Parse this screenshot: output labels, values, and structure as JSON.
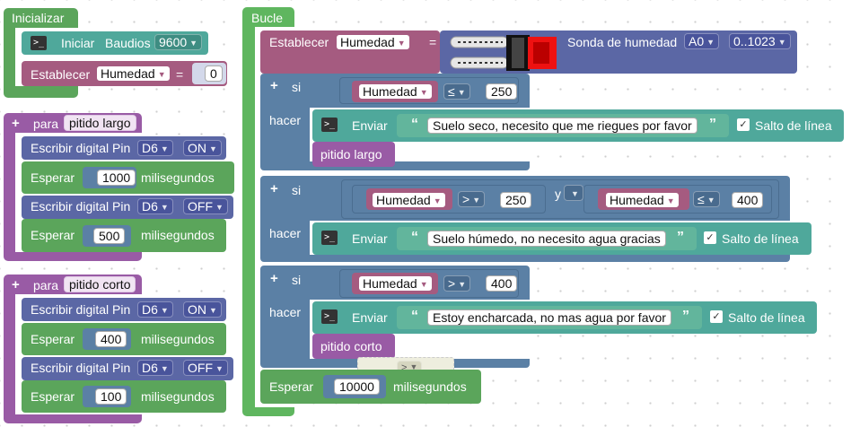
{
  "colors": {
    "green": "#5ba55b",
    "loop_green": "#5fb65f",
    "teal": "#5ba58c",
    "blue": "#5b80a5",
    "purple": "#995ba5",
    "pink": "#a55b80",
    "serial": "#4fa89b"
  },
  "setup": {
    "label": "Inicializar",
    "serial_init": {
      "label": "Iniciar",
      "baud_label": "Baudios",
      "baud_value": "9600"
    },
    "set_var": {
      "label": "Establecer",
      "var": "Humedad",
      "eq": "=",
      "value": "0"
    }
  },
  "proc_long": {
    "plus": "+",
    "label": "para",
    "name": "pitido largo",
    "dw1": {
      "label": "Escribir digital Pin",
      "pin": "D6",
      "state": "ON"
    },
    "wait1": {
      "label": "Esperar",
      "value": "1000",
      "unit": "milisegundos"
    },
    "dw2": {
      "label": "Escribir digital Pin",
      "pin": "D6",
      "state": "OFF"
    },
    "wait2": {
      "label": "Esperar",
      "value": "500",
      "unit": "milisegundos"
    }
  },
  "proc_short": {
    "plus": "+",
    "label": "para",
    "name": "pitido corto",
    "dw1": {
      "label": "Escribir digital Pin",
      "pin": "D6",
      "state": "ON"
    },
    "wait1": {
      "label": "Esperar",
      "value": "400",
      "unit": "milisegundos"
    },
    "dw2": {
      "label": "Escribir digital Pin",
      "pin": "D6",
      "state": "OFF"
    },
    "wait2": {
      "label": "Esperar",
      "value": "100",
      "unit": "milisegundos"
    }
  },
  "loop": {
    "label": "Bucle",
    "set_humidity": {
      "label": "Establecer",
      "var": "Humedad",
      "eq": "=",
      "sensor_label": "Sonda de humedad",
      "pin": "A0",
      "range": "0..1023"
    },
    "if1": {
      "plus": "+",
      "si": "si",
      "hacer": "hacer",
      "var": "Humedad",
      "op": "≤",
      "value": "250",
      "send_label": "Enviar",
      "message": "Suelo seco, necesito que me riegues por favor",
      "newline": "Salto de línea",
      "call": "pitido largo"
    },
    "if2": {
      "plus": "+",
      "si": "si",
      "hacer": "hacer",
      "var_a": "Humedad",
      "op_a": ">",
      "value_a": "250",
      "and": "y",
      "var_b": "Humedad",
      "op_b": "≤",
      "value_b": "400",
      "send_label": "Enviar",
      "message": "Suelo húmedo, no necesito agua gracias",
      "newline": "Salto de línea"
    },
    "if3": {
      "plus": "+",
      "si": "si",
      "hacer": "hacer",
      "var": "Humedad",
      "op": ">",
      "value": "400",
      "send_label": "Enviar",
      "message": "Estoy encharcada, no mas agua por favor",
      "newline": "Salto de línea",
      "call": "pitido corto"
    },
    "ghost_op": ">",
    "wait": {
      "label": "Esperar",
      "value": "10000",
      "unit": "milisegundos"
    }
  }
}
